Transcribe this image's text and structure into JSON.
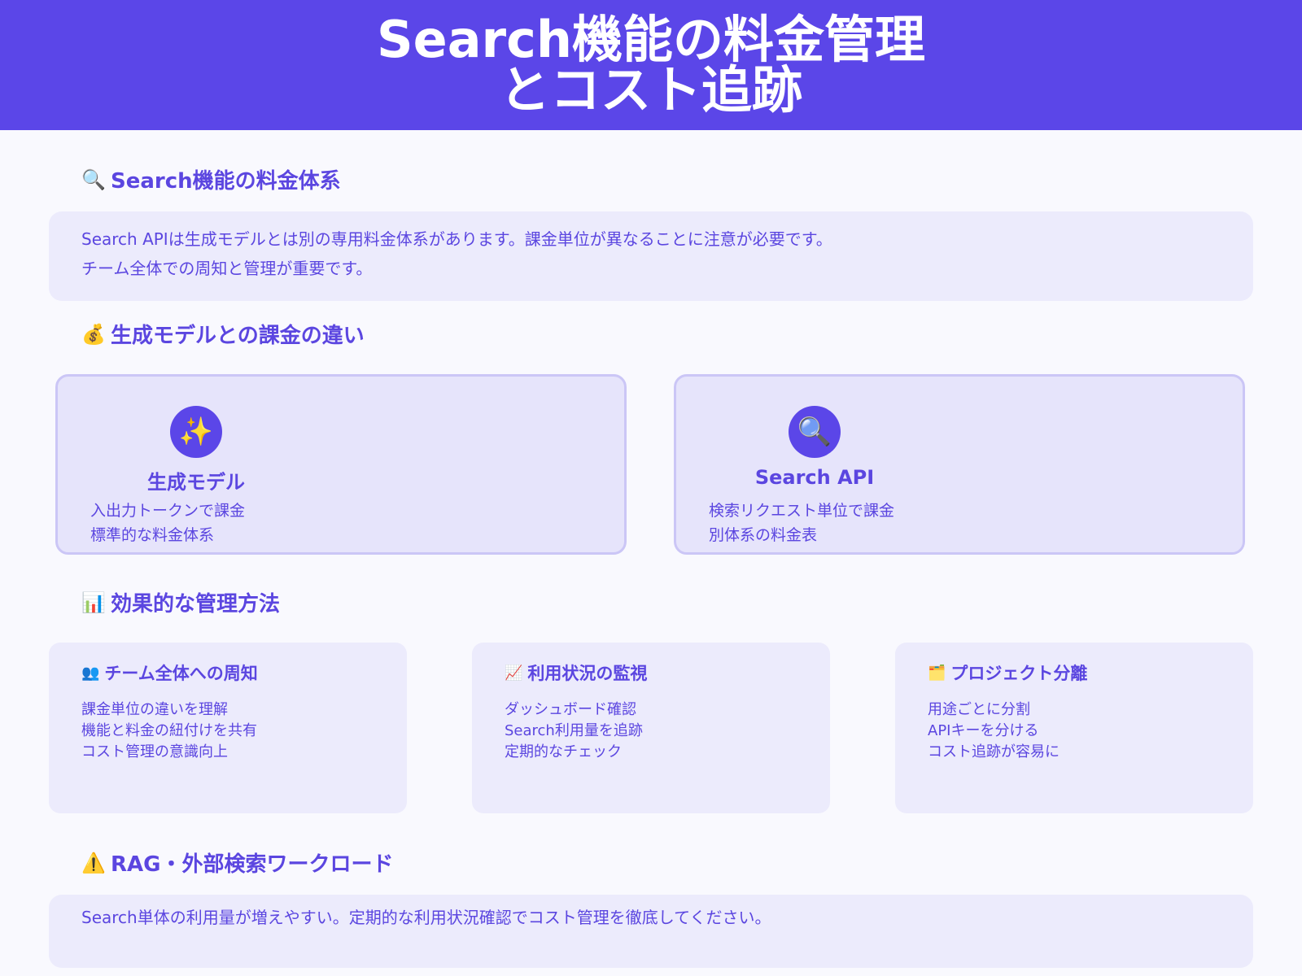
{
  "header": {
    "title_line1": "Search機能の料金管理",
    "title_line2": "とコスト追跡"
  },
  "section_pricing": {
    "icon": "magnifier-icon",
    "icon_glyph": "🔍",
    "title": "Search機能の料金体系",
    "line1": "Search APIは生成モデルとは別の専用料金体系があります。課金単位が異なることに注意が必要です。",
    "line2": "チーム全体での周知と管理が重要です。"
  },
  "section_compare": {
    "icon": "money-bag-icon",
    "icon_glyph": "💰",
    "title": "生成モデルとの課金の違い",
    "cards": [
      {
        "icon": "sparkles-icon",
        "icon_glyph": "✨",
        "title": "生成モデル",
        "line1": "入出力トークンで課金",
        "line2": "標準的な料金体系"
      },
      {
        "icon": "magnifier-icon",
        "icon_glyph": "🔍",
        "title": "Search API",
        "line1": "検索リクエスト単位で課金",
        "line2": "別体系の料金表"
      }
    ]
  },
  "section_methods": {
    "icon": "bar-chart-icon",
    "icon_glyph": "📊",
    "title": "効果的な管理方法",
    "cards": [
      {
        "icon": "people-icon",
        "icon_glyph": "👥",
        "title": "チーム全体への周知",
        "items": [
          "課金単位の違いを理解",
          "機能と料金の紐付けを共有",
          "コスト管理の意識向上"
        ]
      },
      {
        "icon": "trend-chart-icon",
        "icon_glyph": "📈",
        "title": "利用状況の監視",
        "items": [
          "ダッシュボード確認",
          "Search利用量を追跡",
          "定期的なチェック"
        ]
      },
      {
        "icon": "folder-icon",
        "icon_glyph": "🗂️",
        "title": "プロジェクト分離",
        "items": [
          "用途ごとに分割",
          "APIキーを分ける",
          "コスト追跡が容易に"
        ]
      }
    ]
  },
  "section_rag": {
    "icon": "warning-icon",
    "icon_glyph": "⚠️",
    "title": "RAG・外部検索ワークロード",
    "line1": "Search単体の利用量が増えやすい。定期的な利用状況確認でコスト管理を徹底してください。"
  },
  "colors": {
    "header_bg": "#5b46e8",
    "accent": "#5b46e0",
    "panel_bg": "#ecebfc",
    "page_bg": "#f9f9fe"
  }
}
